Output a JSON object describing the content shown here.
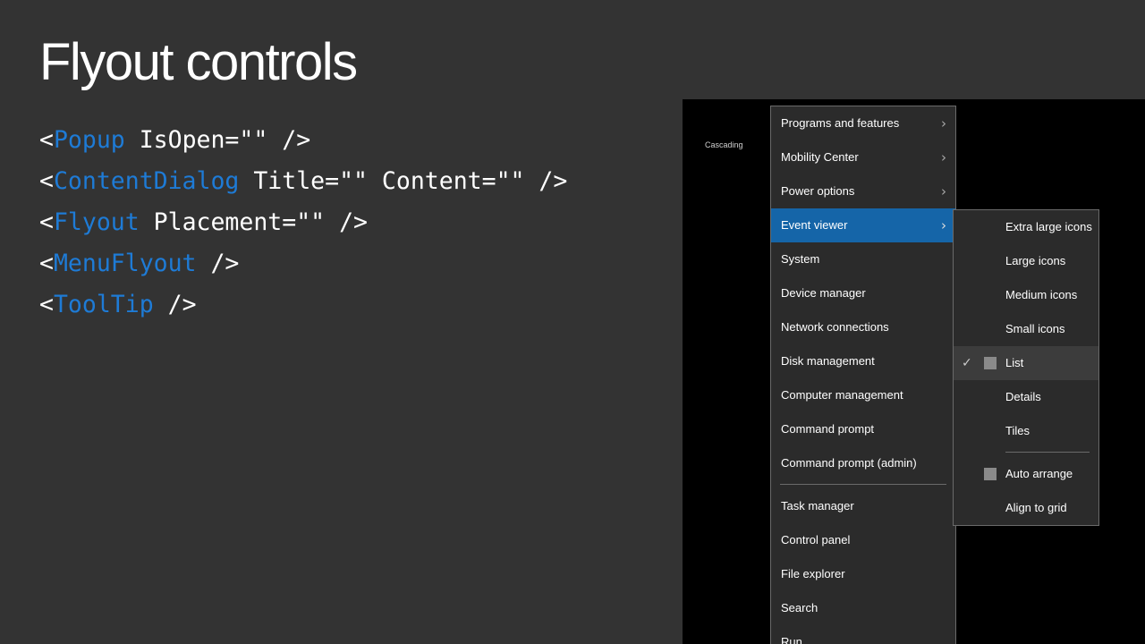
{
  "slide": {
    "title": "Flyout controls",
    "code_lines": [
      {
        "open": "<",
        "tag": "Popup",
        "rest": " IsOpen=\"\" />"
      },
      {
        "open": "<",
        "tag": "ContentDialog",
        "rest": " Title=\"\" Content=\"\" />"
      },
      {
        "open": "<",
        "tag": "Flyout",
        "rest": " Placement=\"\" />"
      },
      {
        "open": "<",
        "tag": "MenuFlyout",
        "rest": " />"
      },
      {
        "open": "<",
        "tag": "ToolTip",
        "rest": " />"
      }
    ]
  },
  "screenshot": {
    "label": "Cascading",
    "menu": {
      "items": [
        {
          "label": "Programs and features",
          "chevron": "›"
        },
        {
          "label": "Mobility Center",
          "chevron": "›"
        },
        {
          "label": "Power options",
          "chevron": "›"
        },
        {
          "label": "Event viewer",
          "chevron": "›"
        },
        {
          "label": "System"
        },
        {
          "label": "Device manager"
        },
        {
          "label": "Network connections"
        },
        {
          "label": "Disk management"
        },
        {
          "label": "Computer management"
        },
        {
          "label": "Command prompt"
        },
        {
          "label": "Command prompt (admin)"
        },
        {
          "label": "Task manager"
        },
        {
          "label": "Control panel"
        },
        {
          "label": "File explorer"
        },
        {
          "label": "Search"
        },
        {
          "label": "Run"
        }
      ]
    },
    "submenu": {
      "items": [
        {
          "label": "Extra large icons"
        },
        {
          "label": "Large icons"
        },
        {
          "label": "Medium icons"
        },
        {
          "label": "Small icons"
        },
        {
          "label": "List",
          "check": "✓"
        },
        {
          "label": "Details"
        },
        {
          "label": "Tiles"
        },
        {
          "label": "Auto arrange"
        },
        {
          "label": "Align to grid"
        }
      ]
    },
    "colors": {
      "accent": "#1565a8",
      "code_tag": "#1e7bd6",
      "background": "#333333"
    }
  }
}
